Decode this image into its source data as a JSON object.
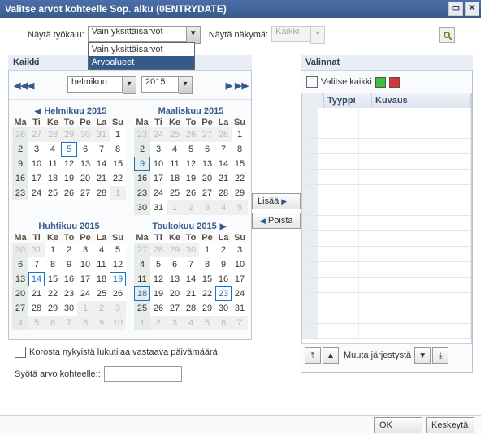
{
  "window": {
    "title": "Valitse arvot kohteelle Sop. alku (0ENTRYDATE)"
  },
  "toolbar": {
    "show_tool": "Näytä työkalu:",
    "show_view": "Näytä näkymä:",
    "dropdown_value": "Vain yksittäisarvot",
    "dropdown": {
      "opt1": "Vain yksittäisarvot",
      "opt2": "Arvoalueet"
    },
    "view_value": "Kaikki"
  },
  "left": {
    "header": "Kaikki",
    "month_selected": "helmikuu",
    "year_selected": "2015",
    "months": {
      "m1": {
        "title": "Helmikuu 2015"
      },
      "m2": {
        "title": "Maaliskuu 2015"
      },
      "m3": {
        "title": "Huhtikuu 2015"
      },
      "m4": {
        "title": "Toukokuu 2015"
      }
    },
    "dow": {
      "d1": "Ma",
      "d2": "Ti",
      "d3": "Ke",
      "d4": "To",
      "d5": "Pe",
      "d6": "La",
      "d7": "Su"
    },
    "chk_label": "Korosta nykyistä lukutilaa vastaava päivämäärä",
    "input_label": "Syötä arvo kohteelle::",
    "input_value": ""
  },
  "middle": {
    "add": "Lisää",
    "remove": "Poista"
  },
  "right": {
    "header": "Valinnat",
    "select_all": "Valitse kaikki",
    "col_type": "Tyyppi",
    "col_desc": "Kuvaus",
    "order_label": "Muuta järjestystä"
  },
  "footer": {
    "ok": "OK",
    "cancel": "Keskeytä"
  },
  "chart_data": {
    "type": "table",
    "title": "Calendar Feb–May 2015",
    "months": [
      {
        "name": "Helmikuu 2015",
        "lead": [
          26,
          27,
          28,
          29,
          30,
          31
        ],
        "days": 28,
        "trail": [
          1
        ],
        "highlight": 5,
        "today": 5
      },
      {
        "name": "Maaliskuu 2015",
        "lead": [
          23,
          24,
          25,
          26,
          27,
          28
        ],
        "days": 31,
        "trail": [
          1,
          2,
          3,
          4,
          5
        ],
        "highlight": 9
      },
      {
        "name": "Huhtikuu 2015",
        "lead": [
          30,
          31
        ],
        "days": 30,
        "trail": [
          1,
          2,
          3,
          4,
          5,
          6,
          7,
          8,
          9,
          10
        ],
        "highlight": [
          14,
          19
        ]
      },
      {
        "name": "Toukokuu 2015",
        "lead": [
          27,
          28,
          29,
          30
        ],
        "days": 31,
        "trail": [
          1,
          2,
          3,
          4,
          5,
          6,
          7
        ],
        "highlight": [
          18,
          23
        ]
      }
    ]
  }
}
